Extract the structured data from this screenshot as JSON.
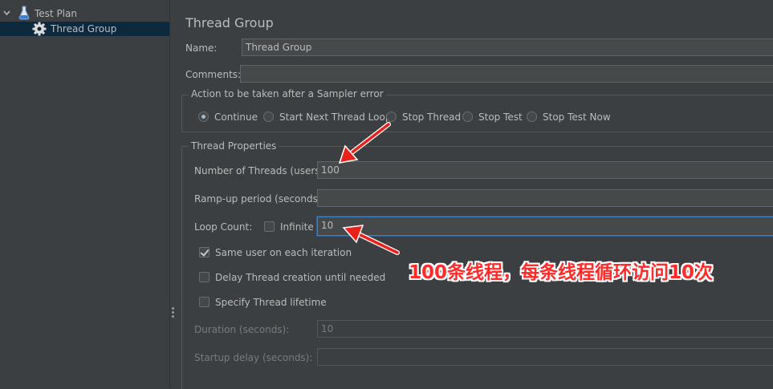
{
  "tree": {
    "items": [
      {
        "label": "Test Plan",
        "icon": "flask-icon",
        "expanded": true
      },
      {
        "label": "Thread Group",
        "icon": "gear-icon",
        "selected": true
      }
    ]
  },
  "panel": {
    "title": "Thread Group",
    "name_label": "Name:",
    "name_value": "Thread Group",
    "comments_label": "Comments:",
    "comments_value": "",
    "sampler_error": {
      "legend": "Action to be taken after a Sampler error",
      "options": [
        "Continue",
        "Start Next Thread Loop",
        "Stop Thread",
        "Stop Test",
        "Stop Test Now"
      ],
      "selected": "Continue"
    },
    "thread_properties": {
      "legend": "Thread Properties",
      "threads_label": "Number of Threads (users):",
      "threads_value": "100",
      "rampup_label": "Ramp-up period (seconds):",
      "rampup_value": "",
      "loop_label": "Loop Count:",
      "infinite_label": "Infinite",
      "infinite_checked": false,
      "loop_value": "10",
      "same_user_label": "Same user on each iteration",
      "same_user_checked": true,
      "delay_label": "Delay Thread creation until needed",
      "delay_checked": false,
      "lifetime_label": "Specify Thread lifetime",
      "lifetime_checked": false,
      "duration_label": "Duration (seconds):",
      "duration_value": "10",
      "startup_label": "Startup delay (seconds):",
      "startup_value": ""
    }
  },
  "annotation": {
    "text": "100条线程，每条线程循环访问10次",
    "color": "#ff2a2a"
  },
  "colors": {
    "background": "#3c3f41",
    "selection": "#0d293e",
    "focus_border": "#3d7ec5",
    "arrow": "#e8221b"
  }
}
